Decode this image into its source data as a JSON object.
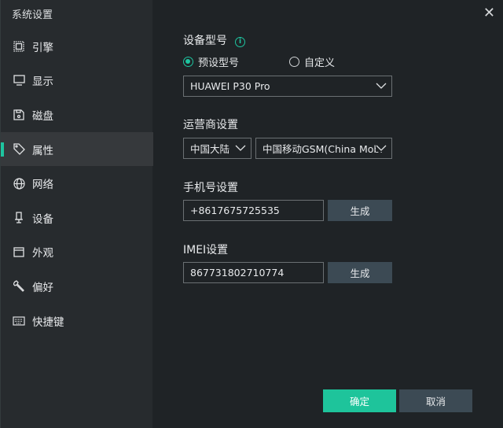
{
  "window": {
    "title": "系统设置"
  },
  "sidebar": {
    "items": [
      {
        "label": "引擎",
        "icon": "chip-icon"
      },
      {
        "label": "显示",
        "icon": "monitor-icon"
      },
      {
        "label": "磁盘",
        "icon": "disk-icon"
      },
      {
        "label": "属性",
        "icon": "tag-icon",
        "active": true
      },
      {
        "label": "网络",
        "icon": "globe-icon"
      },
      {
        "label": "设备",
        "icon": "device-icon"
      },
      {
        "label": "外观",
        "icon": "window-icon"
      },
      {
        "label": "偏好",
        "icon": "wrench-icon"
      },
      {
        "label": "快捷键",
        "icon": "keyboard-icon"
      }
    ]
  },
  "device": {
    "label": "设备型号",
    "preset_label": "预设型号",
    "custom_label": "自定义",
    "model": "HUAWEI P30 Pro"
  },
  "carrier": {
    "label": "运营商设置",
    "region": "中国大陆",
    "operator": "中国移动GSM(China Mobi"
  },
  "phone": {
    "label": "手机号设置",
    "value": "+8617675725535",
    "generate": "生成"
  },
  "imei": {
    "label": "IMEI设置",
    "value": "867731802710774",
    "generate": "生成"
  },
  "footer": {
    "ok": "确定",
    "cancel": "取消"
  },
  "colors": {
    "accent": "#1ec5a0"
  }
}
